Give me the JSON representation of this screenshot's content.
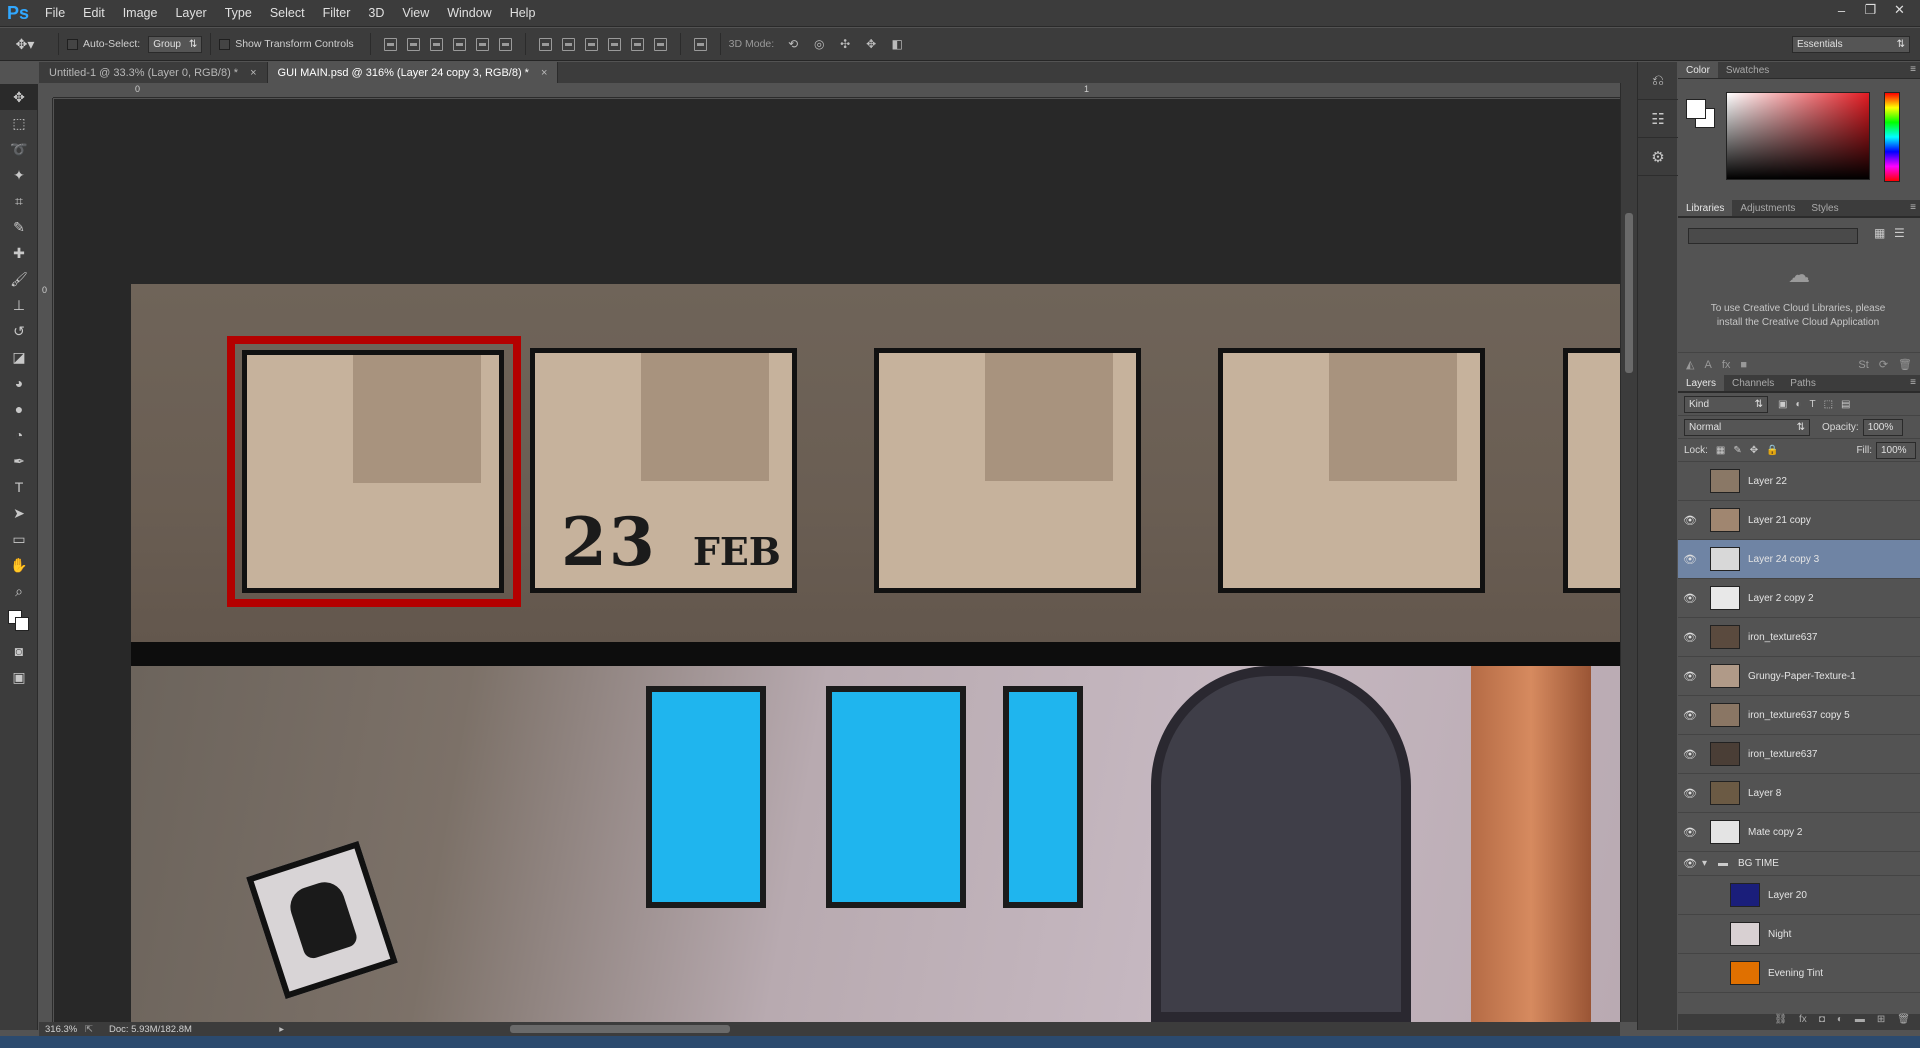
{
  "app": {
    "logo": "Ps"
  },
  "menu": [
    "File",
    "Edit",
    "Image",
    "Layer",
    "Type",
    "Select",
    "Filter",
    "3D",
    "View",
    "Window",
    "Help"
  ],
  "window_controls": [
    "–",
    "❐",
    "✕"
  ],
  "options": {
    "auto_select_label": "Auto-Select:",
    "auto_select_value": "Group",
    "transform_label": "Show Transform Controls",
    "mode3d_label": "3D Mode:",
    "workspace": "Essentials"
  },
  "tabs": [
    {
      "label": "Untitled-1 @ 33.3% (Layer 0, RGB/8) *",
      "close": "×"
    },
    {
      "label": "GUI MAIN.psd @ 316% (Layer 24 copy 3, RGB/8) *",
      "close": "×"
    }
  ],
  "ruler": {
    "top_ticks": [
      "0",
      "1"
    ],
    "left_ticks": [
      "0"
    ]
  },
  "canvas_text": {
    "frame2_day": "23",
    "frame2_month": "FEB"
  },
  "status": {
    "zoom": "316.3%",
    "doc": "Doc: 5.93M/182.8M"
  },
  "panels": {
    "color_tabs": [
      "Color",
      "Swatches"
    ],
    "lib_tabs": [
      "Libraries",
      "Adjustments",
      "Styles"
    ],
    "lib_message": "To use Creative Cloud Libraries, please install the Creative Cloud Application",
    "layers_tabs": [
      "Layers",
      "Channels",
      "Paths"
    ],
    "kind": "Kind",
    "blend": "Normal",
    "opacity_label": "Opacity:",
    "opacity_value": "100%",
    "lock_label": "Lock:",
    "fill_label": "Fill:",
    "fill_value": "100%"
  },
  "layers": [
    {
      "name": "Layer 22",
      "visible": false,
      "color": "#8a7866"
    },
    {
      "name": "Layer 21 copy",
      "visible": true,
      "color": "#a08670"
    },
    {
      "name": "Layer 24 copy 3",
      "visible": true,
      "color": "#d8d8d8",
      "selected": true
    },
    {
      "name": "Layer 2 copy 2",
      "visible": true,
      "color": "#e8e8e8"
    },
    {
      "name": "iron_texture637",
      "visible": true,
      "color": "#5a4a3e"
    },
    {
      "name": "Grungy-Paper-Texture-1",
      "visible": true,
      "color": "#b09a88"
    },
    {
      "name": "iron_texture637 copy 5",
      "visible": true,
      "color": "#8a7664"
    },
    {
      "name": "iron_texture637",
      "visible": true,
      "color": "#4a3e36"
    },
    {
      "name": "Layer 8",
      "visible": true,
      "color": "#6b5a44"
    },
    {
      "name": "Mate  copy 2",
      "visible": true,
      "color": "#e4e4e4"
    }
  ],
  "group": {
    "name": "BG TIME"
  },
  "group_layers": [
    {
      "name": "Layer 20",
      "visible": false,
      "color": "#1a1e7a"
    },
    {
      "name": "Night",
      "visible": false,
      "color": "#d8d0d2"
    },
    {
      "name": "Evening Tint",
      "visible": false,
      "color": "#e07000"
    }
  ]
}
